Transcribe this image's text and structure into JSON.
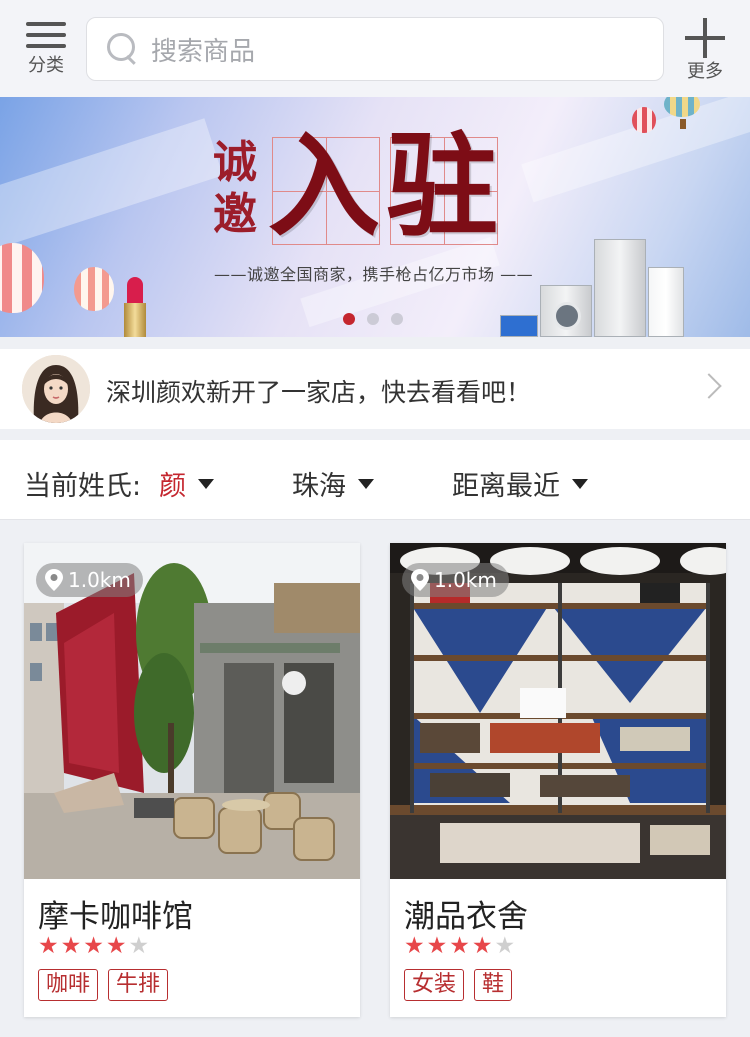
{
  "header": {
    "category_label": "分类",
    "search_placeholder": "搜索商品",
    "more_label": "更多"
  },
  "banner": {
    "title_small": "诚邀",
    "title_big_1": "入",
    "title_big_2": "驻",
    "subtitle": "——诚邀全国商家，携手枪占亿万市场 ——",
    "active_slide": 1,
    "slide_count": 3
  },
  "notice": {
    "text": "深圳颜欢新开了一家店，快去看看吧！"
  },
  "filter": {
    "surname_label": "当前姓氏:",
    "surname_value": "颜",
    "city": "珠海",
    "sort": "距离最近"
  },
  "colors": {
    "accent": "#c4262e",
    "star_on": "#e7474a",
    "star_off": "#cfcfcf"
  },
  "shops": [
    {
      "distance": "1.0km",
      "name": "摩卡咖啡馆",
      "rating": 4,
      "max_rating": 5,
      "tags": [
        "咖啡",
        "牛排"
      ]
    },
    {
      "distance": "1.0km",
      "name": "潮品衣舍",
      "rating": 4,
      "max_rating": 5,
      "tags": [
        "女装",
        "鞋"
      ]
    }
  ]
}
